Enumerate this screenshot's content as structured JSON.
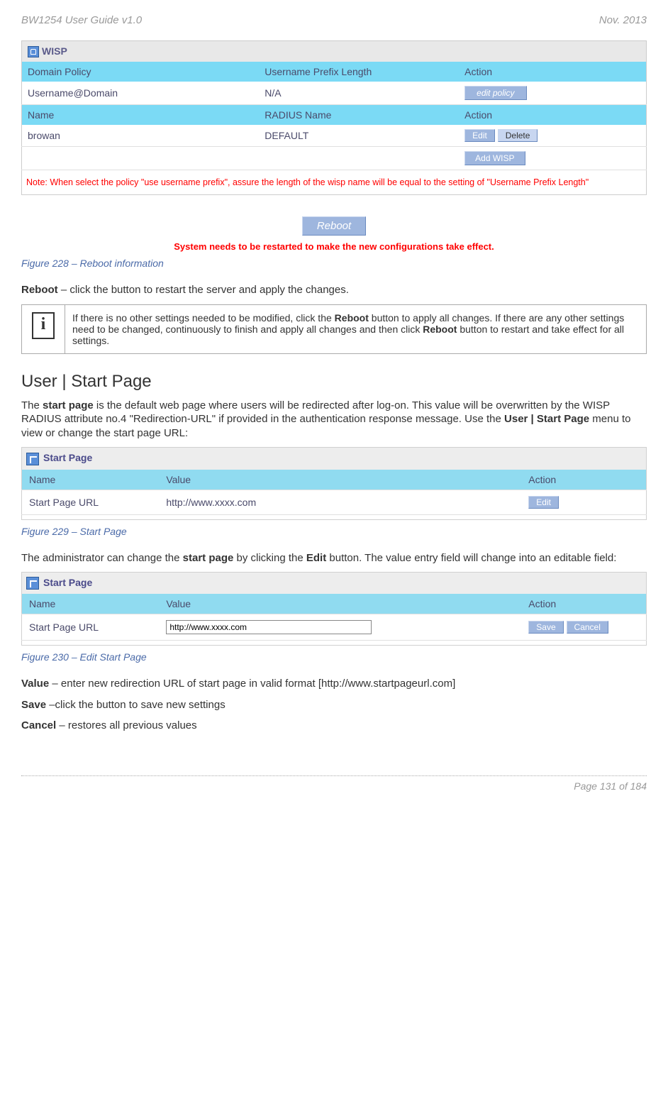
{
  "header": {
    "left": "BW1254 User Guide v1.0",
    "right": "Nov.  2013"
  },
  "wisp_panel": {
    "title": "WISP",
    "headers1": [
      "Domain Policy",
      "Username Prefix Length",
      "Action"
    ],
    "row1": [
      "Username@Domain",
      "N/A"
    ],
    "edit_policy_btn": "edit  policy",
    "headers2": [
      "Name",
      "RADIUS Name",
      "Action"
    ],
    "row2": [
      "browan",
      "DEFAULT"
    ],
    "edit_btn": "Edit",
    "delete_btn": "Delete",
    "add_btn": "Add WISP",
    "note": "Note: When select the policy \"use username prefix\", assure the length of the wisp name will be equal to the setting of \"Username Prefix Length\""
  },
  "reboot_section": {
    "button": "Reboot",
    "message": "System needs to be restarted to make the new configurations take effect."
  },
  "figure228": "Figure 228 – Reboot information",
  "reboot_desc": {
    "label": "Reboot",
    "text": " – click the button to restart the server and apply the changes."
  },
  "info_box": "If there is no other settings needed to be modified, click the Reboot button to apply all changes. If there are any other settings need to be changed, continuously to finish and apply all changes and then click Reboot button to restart and take effect  for all settings.",
  "section_title": "User | Start Page",
  "startpage_intro": "The start page is the default web page where users will be redirected after log-on. This value will be overwritten by the WISP RADIUS attribute no.4 \"Redirection-URL\" if provided in the authentication response message. Use the User | Start Page menu to view or change the start page URL:",
  "startpage_table1": {
    "title": "Start Page",
    "headers": [
      "Name",
      "Value",
      "Action"
    ],
    "name": "Start Page URL",
    "value": "http://www.xxxx.com",
    "edit_btn": "Edit"
  },
  "figure229": "Figure 229 – Start Page",
  "admin_text": "The administrator can change the start page by clicking the Edit button. The value entry field will change into an editable field:",
  "startpage_table2": {
    "title": "Start Page",
    "headers": [
      "Name",
      "Value",
      "Action"
    ],
    "name": "Start Page URL",
    "value": "http://www.xxxx.com",
    "save_btn": "Save",
    "cancel_btn": "Cancel"
  },
  "figure230": "Figure 230 – Edit Start Page",
  "value_desc": {
    "label": "Value",
    "text": " – enter new redirection URL of start page in valid format [http://www.startpageurl.com]"
  },
  "save_desc": {
    "label": "Save",
    "text": " –click the button to save new settings"
  },
  "cancel_desc": {
    "label": "Cancel",
    "text": " – restores all previous values"
  },
  "footer": "Page 131 of 184"
}
